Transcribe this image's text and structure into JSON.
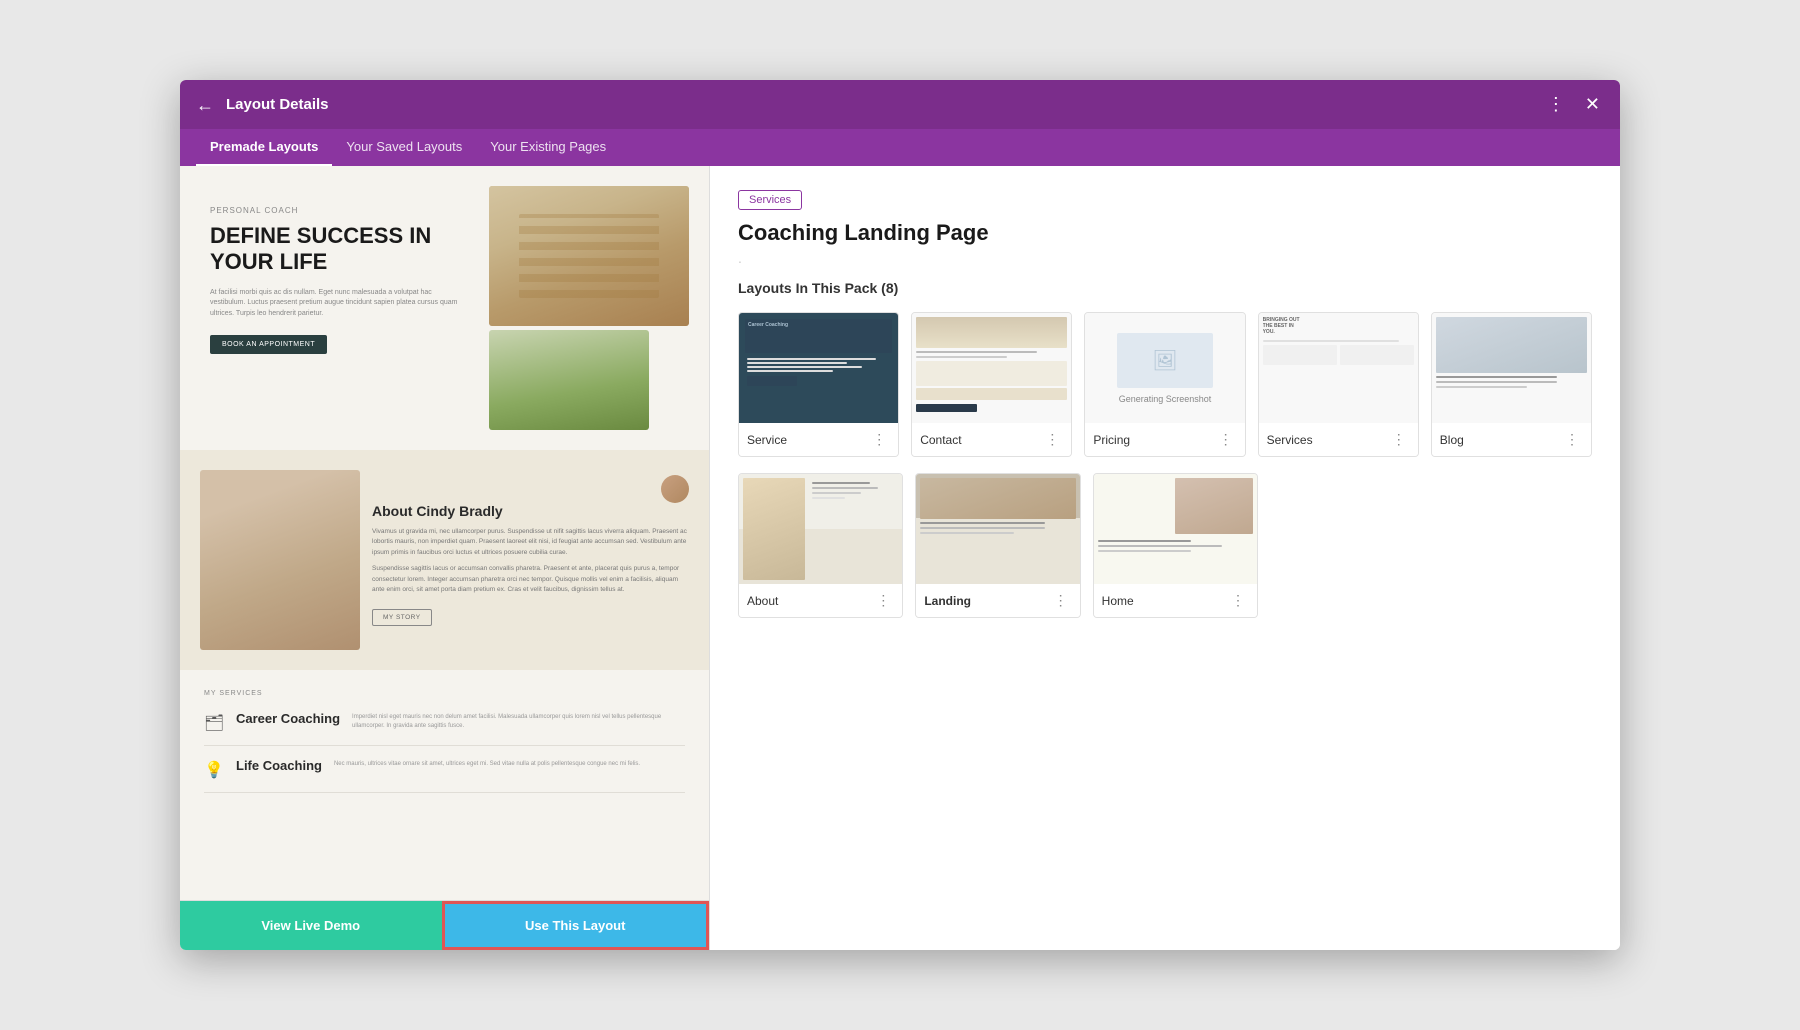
{
  "modal": {
    "title": "Layout Details",
    "close_icon": "✕",
    "settings_icon": "⚙"
  },
  "tabs": [
    {
      "label": "Premade Layouts",
      "active": true
    },
    {
      "label": "Your Saved Layouts",
      "active": false
    },
    {
      "label": "Your Existing Pages",
      "active": false
    }
  ],
  "preview": {
    "hero": {
      "label": "PERSONAL COACH",
      "title": "DEFINE SUCCESS IN YOUR LIFE",
      "description": "At facilisi morbi quis ac dis nullam. Eget nunc malesuada a volutpat hac vestibulum. Luctus praesent pretium augue tincidunt sapien platea cursus quam ultrices. Turpis leo hendrerit parietur.",
      "button": "BOOK AN APPOINTMENT"
    },
    "about": {
      "name": "About Cindy Bradly",
      "description1": "Vivamus ut gravida mi, nec ullamcorper purus. Suspendisse ut nifit sagittis lacus viverra aliquam. Praesent ac lobortis mauris, non imperdiet quam. Praesent laoreet elit nisi, id feugiat ante accumsan sed. Vestibulum ante ipsum primis in faucibus orci luctus et ultrices posuere cubilia curae.",
      "description2": "Suspendisse sagittis lacus or accumsan convallis pharetra. Praesent et ante, placerat quis purus a, tempor consectetur lorem. Integer accumsan pharetra orci nec tempor. Quisque mollis vel enim a facilisis, aliquam ante enim orci, sit amet porta diam pretium ex. Cras et velit faucibus, dignissim tellus at.",
      "button": "MY STORY"
    },
    "services": {
      "label": "MY SERVICES",
      "items": [
        {
          "icon": "🗂",
          "name": "Career Coaching",
          "description": "Imperdiet nisl eget mauris nec non delum amet facilisi. Malesuada ullamcorper quis lorem nisl vel tellus pellentesque ullamcorper. In gravida ante sagittis fusce."
        },
        {
          "icon": "💡",
          "name": "Life Coaching",
          "description": "Nec mauris, ultrices vitae ornare sit amet, ultrices eget mi. Sed vitae nulla at polis pellentesque congue nec mi felis."
        }
      ]
    },
    "actions": {
      "live_demo": "View Live Demo",
      "use_layout": "Use This Layout"
    }
  },
  "right_panel": {
    "pack_tag": "Services",
    "pack_title": "Coaching Landing Page",
    "pack_dot": ".",
    "layouts_label": "Layouts In This Pack (8)",
    "layouts": [
      {
        "name": "Service",
        "bold": false,
        "type": "service"
      },
      {
        "name": "Contact",
        "bold": false,
        "type": "contact"
      },
      {
        "name": "Pricing",
        "bold": false,
        "type": "pricing"
      },
      {
        "name": "Services",
        "bold": false,
        "type": "services2"
      },
      {
        "name": "Blog",
        "bold": false,
        "type": "blog"
      },
      {
        "name": "About",
        "bold": false,
        "type": "about"
      },
      {
        "name": "Landing",
        "bold": true,
        "type": "landing"
      },
      {
        "name": "Home",
        "bold": false,
        "type": "home"
      }
    ]
  }
}
